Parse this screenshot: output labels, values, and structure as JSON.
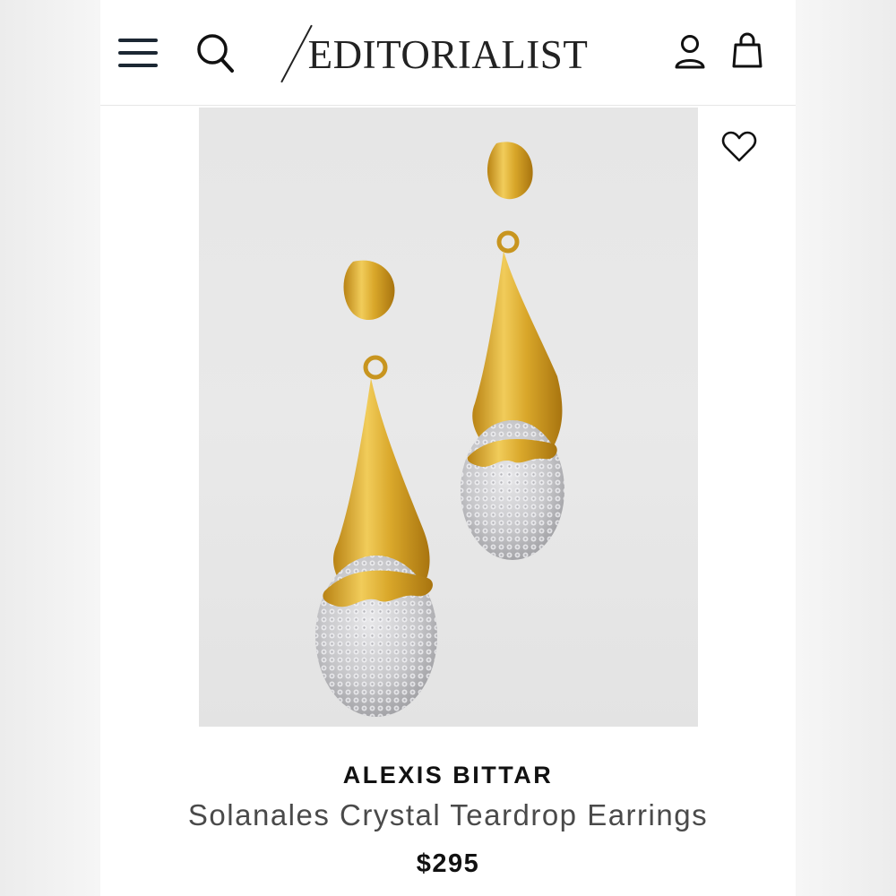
{
  "header": {
    "logo": "EDITORIALIST",
    "menu_icon": "hamburger-menu-icon",
    "search_icon": "search-icon",
    "account_icon": "user-icon",
    "bag_icon": "shopping-bag-icon"
  },
  "product": {
    "wishlist_icon": "heart-icon",
    "brand": "ALEXIS BITTAR",
    "name": "Solanales Crystal Teardrop Earrings",
    "price": "$295"
  },
  "colors": {
    "gold": "#d9a72a",
    "crystal": "#c9c9cc",
    "text": "#111111",
    "nav_icon": "#1c2733"
  }
}
